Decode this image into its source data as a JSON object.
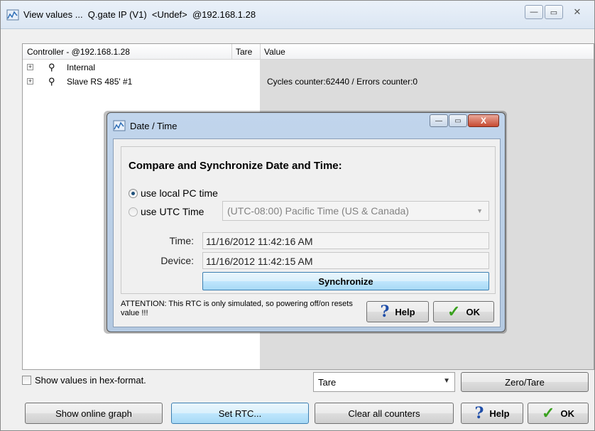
{
  "window": {
    "title": "View values ...  Q.gate IP (V1)  <Undef>  @192.168.1.28",
    "app_icon": "gauge-app-icon",
    "controls": {
      "minimize": "—",
      "maximize": "▭",
      "close": "✕"
    }
  },
  "tree": {
    "columns": [
      "Controller - @192.168.1.28",
      "Tare",
      "Value"
    ],
    "rows": [
      {
        "expander": "+",
        "icon": "plug-icon",
        "label": "Internal",
        "value": ""
      },
      {
        "expander": "+",
        "icon": "plug-icon",
        "label": "Slave RS 485' #1",
        "value": "Cycles counter:62440 / Errors counter:0"
      }
    ]
  },
  "bottom": {
    "hex_checkbox_label": "Show values in hex-format.",
    "hex_checked": false,
    "tare_select_value": "Tare",
    "zero_tare_label": "Zero/Tare",
    "show_graph_label": "Show online graph",
    "set_rtc_label": "Set RTC...",
    "clear_counters_label": "Clear all counters",
    "help_label": "Help",
    "ok_label": "OK"
  },
  "dialog": {
    "title": "Date / Time",
    "heading": "Compare and Synchronize Date and Time:",
    "radio_local_label": "use local PC time",
    "radio_utc_label": "use UTC Time",
    "selected_mode": "local",
    "timezone_value": "(UTC-08:00) Pacific Time (US & Canada)",
    "time_label": "Time:",
    "time_value": "11/16/2012 11:42:16 AM",
    "device_label": "Device:",
    "device_value": "11/16/2012 11:42:15 AM",
    "sync_label": "Synchronize",
    "attention_text": "ATTENTION: This RTC is only simulated, so powering off/on resets value !!!",
    "help_label": "Help",
    "ok_label": "OK",
    "controls": {
      "minimize": "—",
      "maximize": "▭",
      "close": "X"
    }
  },
  "colors": {
    "accent_blue": "#a7d9f5",
    "dialog_frame": "#b4c9e1",
    "help_icon": "#1f4ea8",
    "ok_check": "#3aa11f"
  }
}
